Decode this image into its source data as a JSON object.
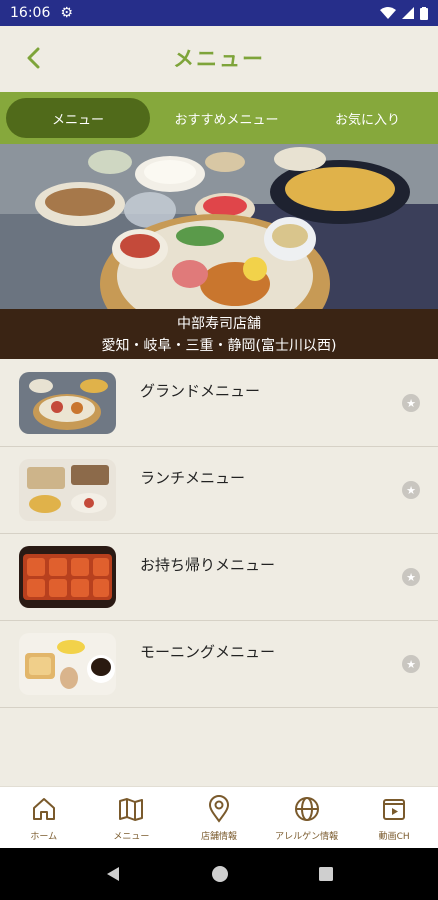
{
  "status_bar": {
    "time": "16:06"
  },
  "header": {
    "title": "メニュー"
  },
  "tabs": [
    {
      "label": "メニュー",
      "active": true
    },
    {
      "label": "おすすめメニュー",
      "active": false
    },
    {
      "label": "お気に入り",
      "active": false
    }
  ],
  "hero": {
    "line1": "中部寿司店舗",
    "line2": "愛知・岐阜・三重・静岡(富士川以西)"
  },
  "menu_items": [
    {
      "label": "グランドメニュー",
      "image": "set-meal-photo"
    },
    {
      "label": "ランチメニュー",
      "image": "lunch-set-photo"
    },
    {
      "label": "お持ち帰りメニュー",
      "image": "takeout-photo"
    },
    {
      "label": "モーニングメニュー",
      "image": "morning-photo"
    }
  ],
  "bottom_nav": [
    {
      "label": "ホーム",
      "icon": "home-icon"
    },
    {
      "label": "メニュー",
      "icon": "map-book-icon"
    },
    {
      "label": "店舗情報",
      "icon": "location-pin-icon"
    },
    {
      "label": "アレルゲン情報",
      "icon": "globe-icon"
    },
    {
      "label": "動画CH",
      "icon": "video-icon"
    }
  ],
  "colors": {
    "accent_green": "#86a83c",
    "active_tab": "#506a1a",
    "title_green": "#7ea43a",
    "status_bar": "#262e8a",
    "caption_bg": "#3a2414"
  }
}
